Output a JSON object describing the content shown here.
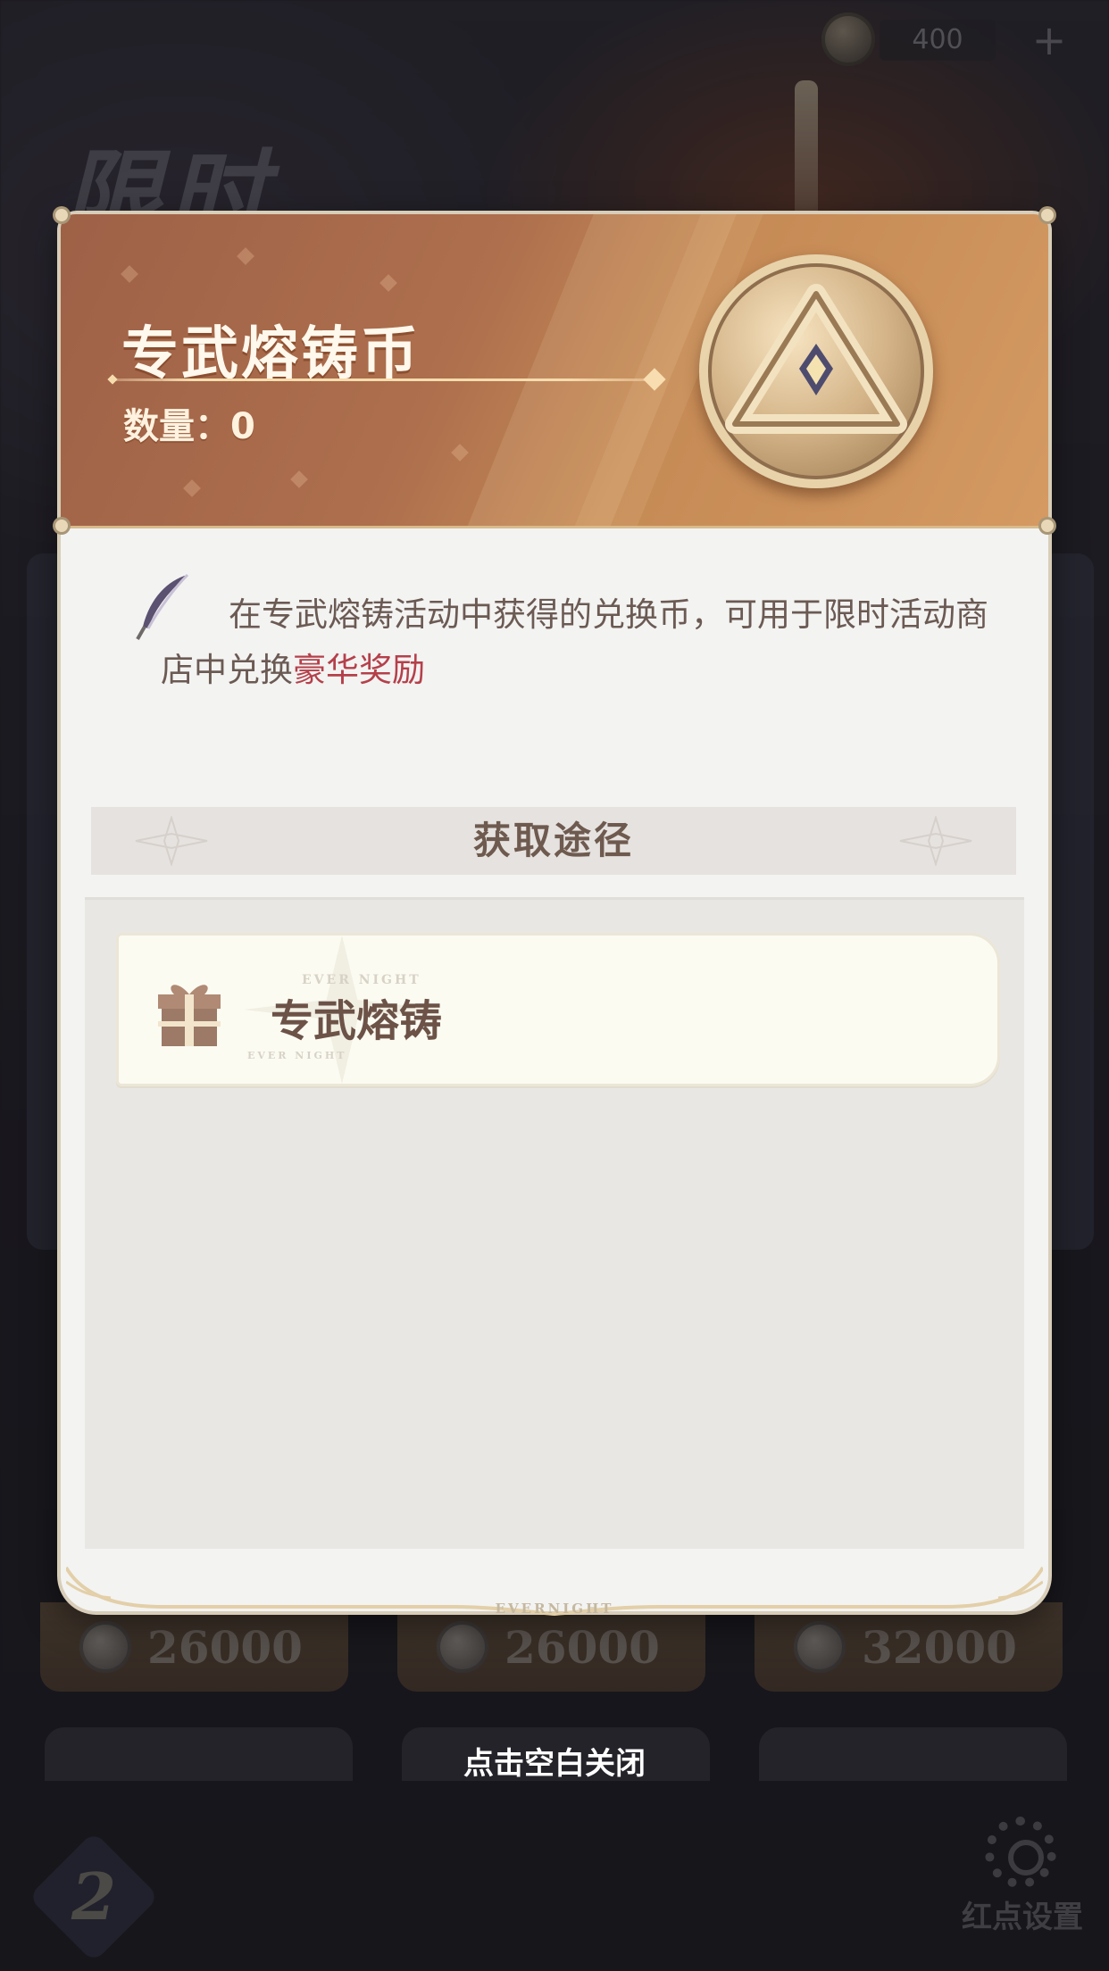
{
  "top_bar": {
    "currency_amount": "400",
    "add_symbol": "+"
  },
  "background": {
    "event_title": "限时",
    "prices": [
      "26000",
      "26000",
      "32000"
    ],
    "settings_label": "红点设置"
  },
  "item_popup": {
    "title": "专武熔铸币",
    "quantity_label": "数量：",
    "quantity_value": "0",
    "description_prefix": "在专武熔铸活动中获得的兑换币，可用于限时活动商店中兑换",
    "description_highlight": "豪华奖励",
    "sources_header": "获取途径",
    "sources": [
      {
        "label": "专武熔铸",
        "icon": "gift-box-icon"
      }
    ],
    "watermark_small": "EVER NIGHT",
    "footer_mark": "EVERNIGHT"
  },
  "close_hint": "点击空白关闭",
  "colors": {
    "header_gradient_start": "#9e6147",
    "header_gradient_end": "#d49a62",
    "highlight_text": "#b5404a",
    "panel_bg": "#f3f3f2"
  }
}
